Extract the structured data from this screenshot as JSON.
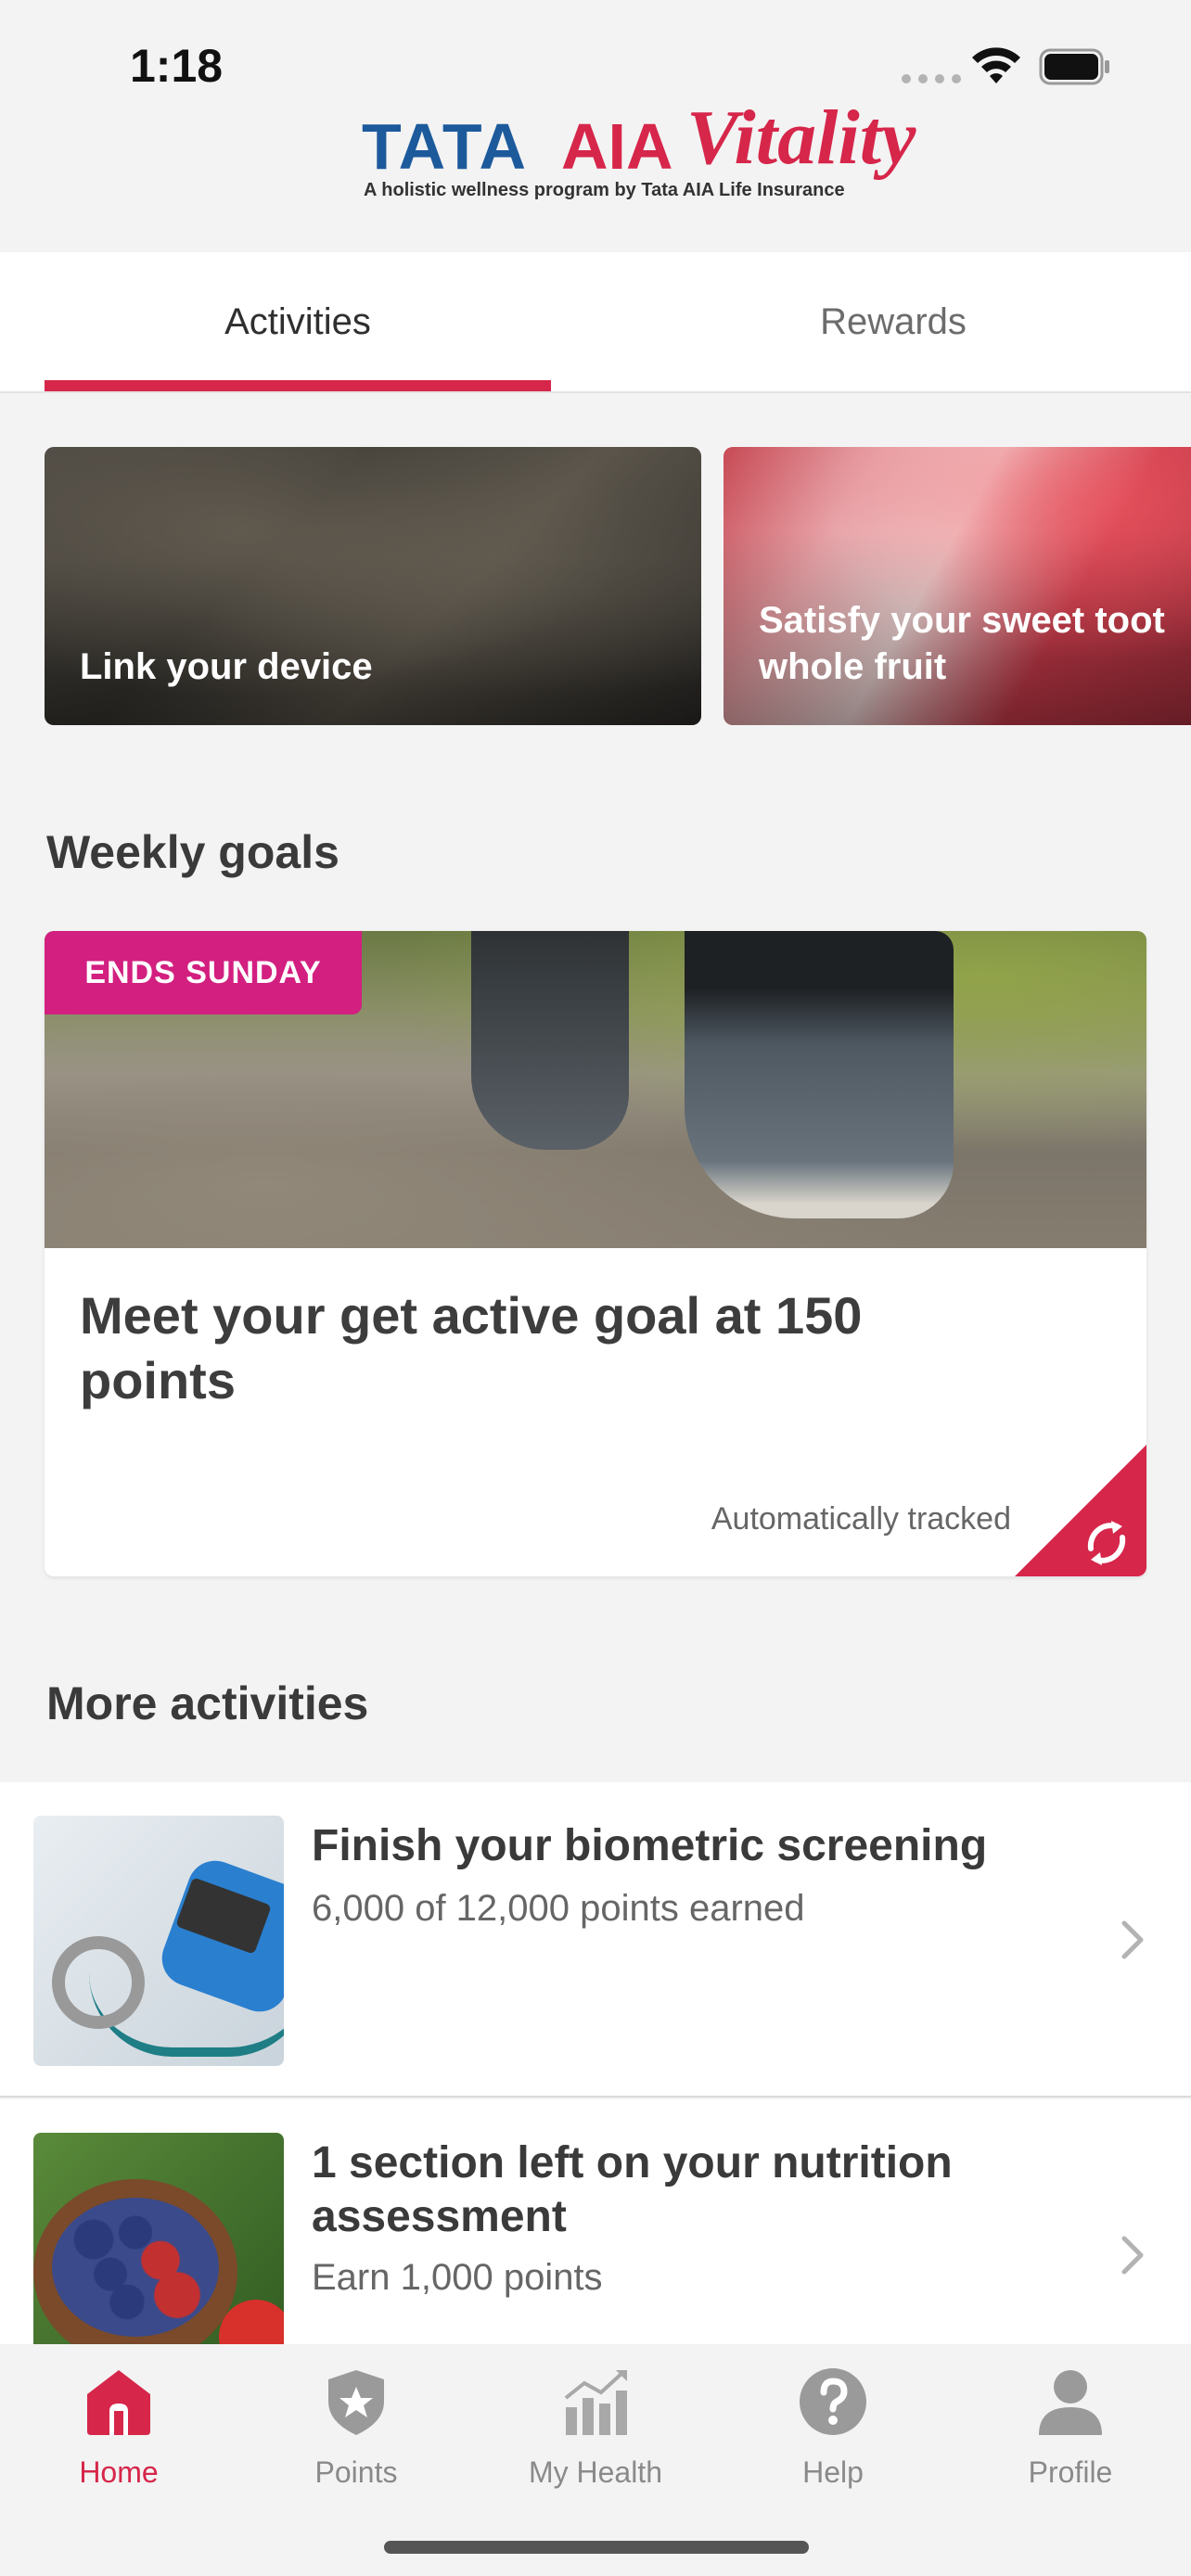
{
  "status_bar": {
    "time": "1:18"
  },
  "header": {
    "logo": {
      "tata": "TATA",
      "aia": "AIA",
      "vitality": "Vitality",
      "tagline": "A holistic wellness program by Tata AIA Life Insurance"
    }
  },
  "tabs": [
    {
      "label": "Activities",
      "active": true
    },
    {
      "label": "Rewards",
      "active": false
    }
  ],
  "promos": [
    {
      "label": "Link your device"
    },
    {
      "label": "Satisfy your sweet toot\nwhole fruit"
    }
  ],
  "weekly_goals": {
    "heading": "Weekly goals",
    "card": {
      "badge": "ENDS SUNDAY",
      "title": "Meet your get active goal at 150 points",
      "tracked_label": "Automatically tracked"
    }
  },
  "more_activities": {
    "heading": "More activities",
    "items": [
      {
        "title": "Finish your biometric screening",
        "subtitle": "6,000 of 12,000 points earned",
        "thumbnail": "biometric-screening-image"
      },
      {
        "title": "1 section left on your nutrition assessment",
        "subtitle": "Earn 1,000 points",
        "thumbnail": "nutrition-bowl-image"
      }
    ]
  },
  "bottom_nav": [
    {
      "label": "Home",
      "icon": "home-icon",
      "active": true
    },
    {
      "label": "Points",
      "icon": "points-badge-icon",
      "active": false
    },
    {
      "label": "My Health",
      "icon": "health-chart-icon",
      "active": false
    },
    {
      "label": "Help",
      "icon": "help-icon",
      "active": false
    },
    {
      "label": "Profile",
      "icon": "profile-icon",
      "active": false
    }
  ],
  "colors": {
    "accent": "#d6264a",
    "badge": "#d21f80",
    "brand_blue": "#1c5a9c"
  }
}
